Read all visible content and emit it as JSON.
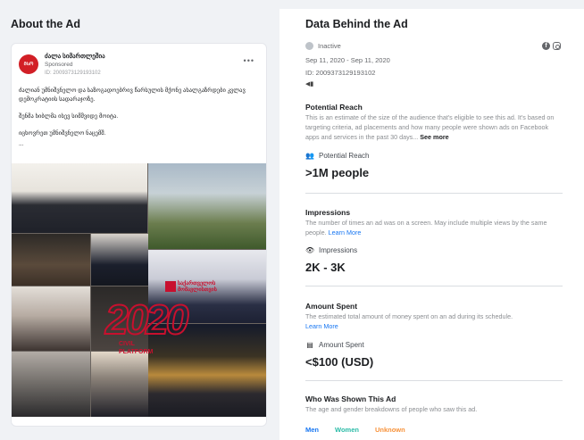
{
  "left": {
    "title": "About the Ad",
    "card": {
      "avatar_text": "ᲛᲡᲝ",
      "page_name": "ძალა სიმართლეშია",
      "sponsored": "Sponsored",
      "ad_id": "ID: 2009373129193102",
      "more": "•••",
      "body": [
        "ძალიან უმნიშვნელო და საზოგადოებრივ წარსულის მქონე ახალგაზრდები კვლავ დემოკრატიის სადარაჯოზე.",
        "შენმა ხიბლმა ისევ სიმშვიდე მოიტა.",
        "იცხოვრეთ უმნიშვნელო ნაცემშ.",
        "..."
      ],
      "overlay": {
        "year": "2020",
        "small_text": "საქართველოს\nმომავლისთვის",
        "civil_text": "CIVIL\nPLATFORM"
      }
    }
  },
  "right": {
    "title": "Data Behind the Ad",
    "status": "Inactive",
    "dates": "Sep 11, 2020 - Sep 11, 2020",
    "ad_id": "ID: 2009373129193102",
    "potential_reach": {
      "title": "Potential Reach",
      "desc": "This is an estimate of the size of the audience that's eligible to see this ad. It's based on targeting criteria, ad placements and how many people were shown ads on Facebook apps and services in the past 30 days...",
      "see_more": "See more",
      "label": "Potential Reach",
      "value": ">1M people"
    },
    "impressions": {
      "title": "Impressions",
      "desc": "The number of times an ad was on a screen. May include multiple views by the same people.",
      "learn_more": "Learn More",
      "label": "Impressions",
      "value": "2K - 3K"
    },
    "amount_spent": {
      "title": "Amount Spent",
      "desc": "The estimated total amount of money spent on an ad during its schedule.",
      "learn_more": "Learn More",
      "label": "Amount Spent",
      "value": "<$100 (USD)"
    },
    "who_shown": {
      "title": "Who Was Shown This Ad",
      "desc": "The age and gender breakdowns of people who saw this ad.",
      "men": "Men",
      "women": "Women",
      "unknown": "Unknown"
    }
  },
  "colors": {
    "men": "#1877f2",
    "women": "#2abba7",
    "unknown": "#f7923a",
    "link": "#1877f2",
    "brand_red": "#c8102e"
  }
}
